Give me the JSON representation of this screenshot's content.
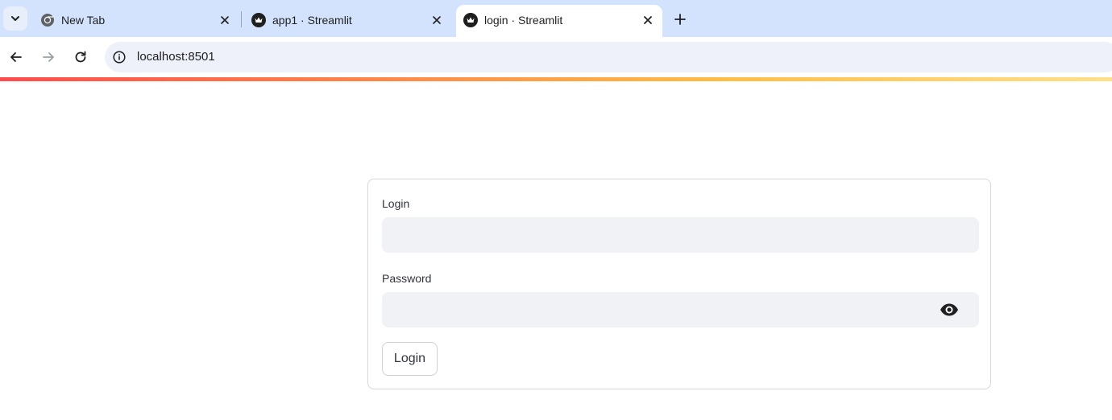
{
  "browser": {
    "tabs": [
      {
        "title": "New Tab",
        "icon": "chrome-icon",
        "active": false
      },
      {
        "title": "app1 · Streamlit",
        "icon": "streamlit-crown-icon",
        "active": false
      },
      {
        "title": "login · Streamlit",
        "icon": "streamlit-crown-icon",
        "active": true
      }
    ],
    "url": "localhost:8501"
  },
  "form": {
    "login_label": "Login",
    "login_value": "",
    "password_label": "Password",
    "password_value": "",
    "submit_label": "Login"
  },
  "colors": {
    "tabstrip_bg": "#d3e3fd",
    "omnibox_bg": "#eef1fa",
    "input_bg": "#f0f2f6",
    "text": "#31333f",
    "decoration_gradient": [
      "#ff4b4b",
      "#ffbd45",
      "#ffe08a"
    ]
  }
}
